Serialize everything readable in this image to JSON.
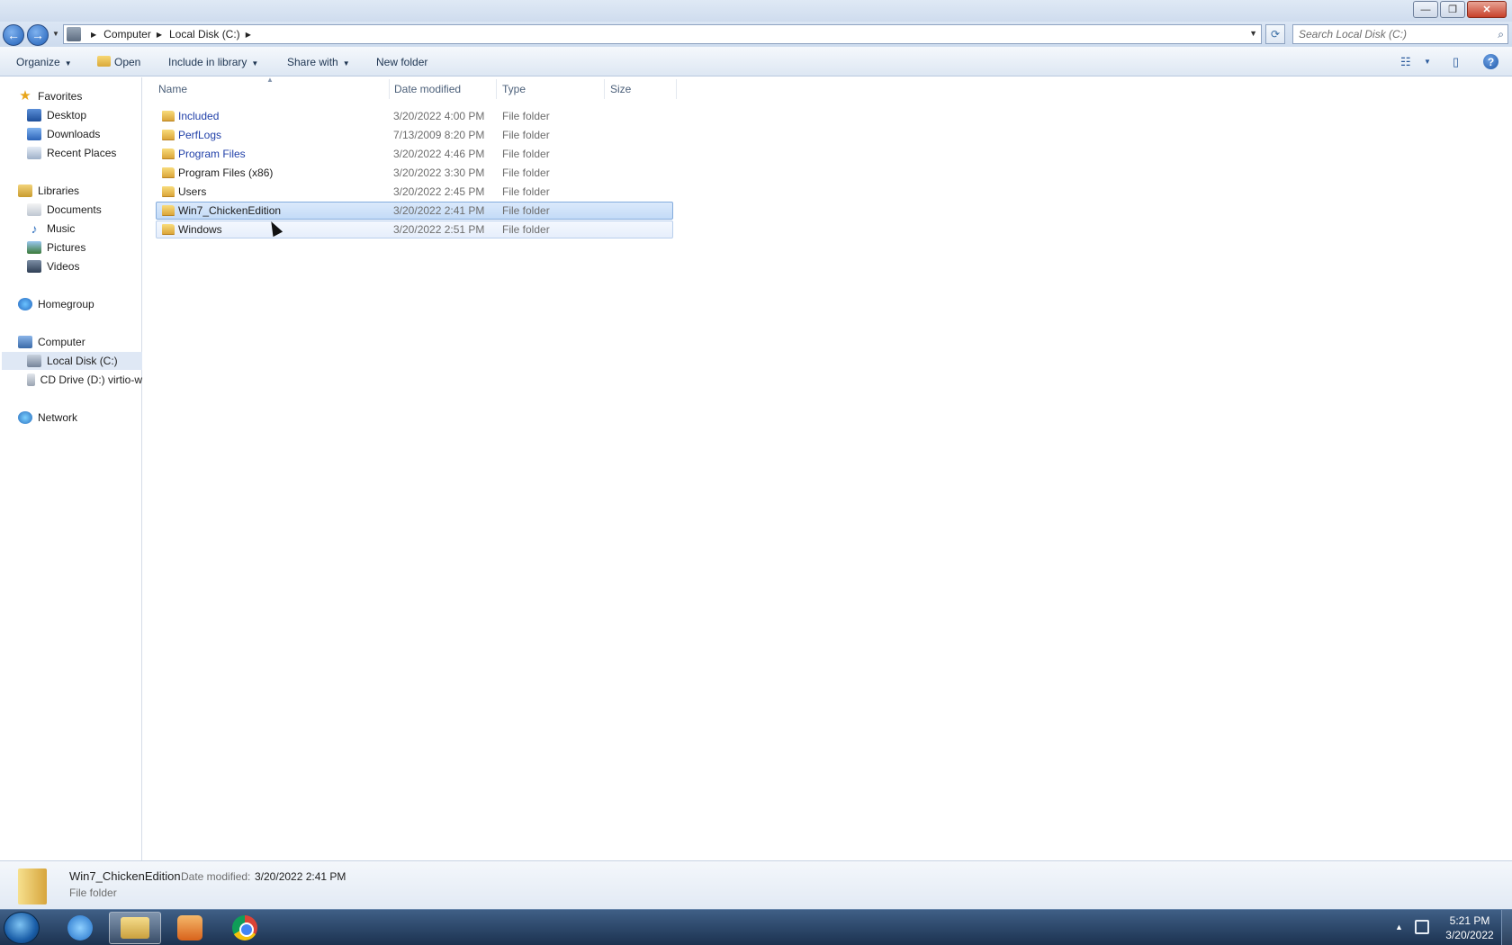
{
  "window": {
    "buttons": {
      "minimize": "—",
      "maximize": "❐",
      "close": "✕"
    }
  },
  "address": {
    "crumbs": [
      "Computer",
      "Local Disk (C:)"
    ],
    "search_placeholder": "Search Local Disk (C:)"
  },
  "toolbar": {
    "organize": "Organize",
    "open": "Open",
    "include_in_library": "Include in library",
    "share_with": "Share with",
    "new_folder": "New folder"
  },
  "nav": {
    "favorites": "Favorites",
    "desktop": "Desktop",
    "downloads": "Downloads",
    "recent_places": "Recent Places",
    "libraries": "Libraries",
    "documents": "Documents",
    "music": "Music",
    "pictures": "Pictures",
    "videos": "Videos",
    "homegroup": "Homegroup",
    "computer": "Computer",
    "local_disk": "Local Disk (C:)",
    "cd_drive": "CD Drive (D:) virtio-w",
    "network": "Network"
  },
  "columns": {
    "name": "Name",
    "date_modified": "Date modified",
    "type": "Type",
    "size": "Size"
  },
  "files": [
    {
      "name": "Included",
      "date": "3/20/2022 4:00 PM",
      "type": "File folder"
    },
    {
      "name": "PerfLogs",
      "date": "7/13/2009 8:20 PM",
      "type": "File folder"
    },
    {
      "name": "Program Files",
      "date": "3/20/2022 4:46 PM",
      "type": "File folder"
    },
    {
      "name": "Program Files (x86)",
      "date": "3/20/2022 3:30 PM",
      "type": "File folder"
    },
    {
      "name": "Users",
      "date": "3/20/2022 2:45 PM",
      "type": "File folder"
    },
    {
      "name": "Win7_ChickenEdition",
      "date": "3/20/2022 2:41 PM",
      "type": "File folder"
    },
    {
      "name": "Windows",
      "date": "3/20/2022 2:51 PM",
      "type": "File folder"
    }
  ],
  "details": {
    "name": "Win7_ChickenEdition",
    "date_label": "Date modified:",
    "date_value": "3/20/2022 2:41 PM",
    "type": "File folder"
  },
  "taskbar": {
    "time": "5:21 PM",
    "date": "3/20/2022"
  },
  "icons": {
    "back": "←",
    "forward": "→",
    "refresh": "⟳",
    "search": "⌕",
    "help": "?",
    "views": "☷",
    "preview_pane": "▯"
  },
  "colors": {
    "selection": "#c3dbf7",
    "selection_border": "#84acdd",
    "link_blue": "#1f3fa8",
    "taskbar": "#1c3250"
  }
}
